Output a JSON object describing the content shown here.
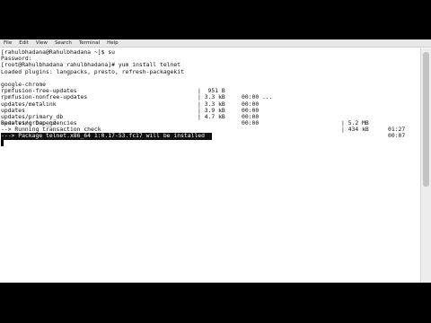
{
  "menu": [
    "File",
    "Edit",
    "View",
    "Search",
    "Terminal",
    "Help"
  ],
  "lines": [
    {
      "text": "[rahulbhadana@Rahulbhadana ~]$ su"
    },
    {
      "text": "Password:"
    },
    {
      "text": "[root@Rahulbhadana rahulbhadana]# yum install telnet"
    },
    {
      "text": "Loaded plugins: langpacks, presto, refresh-packagekit"
    },
    {
      "repo": "google-chrome",
      "size": "|  951 B",
      "time": "00:00 ..."
    },
    {
      "repo": "rpmfusion-free-updates",
      "size": "| 3.3 kB",
      "time": "00:00"
    },
    {
      "repo": "rpmfusion-nonfree-updates",
      "size": "| 3.3 kB",
      "time": "00:00"
    },
    {
      "repo": "updates/metalink",
      "size": "| 3.9 kB",
      "time": "00:00"
    },
    {
      "repo": "updates",
      "size": "| 4.7 kB",
      "time": "00:00"
    },
    {
      "repo": "updates/primary_db",
      "size2": "| 5.2 MB",
      "time2": "01:27"
    },
    {
      "repo": "updates/group_gz",
      "size2": "| 434 kB",
      "time2": "00:07"
    },
    {
      "text": "Resolving Dependencies"
    },
    {
      "text": "--> Running transaction check"
    }
  ],
  "highlight": "---> Package telnet.x86_64 1:0.17-53.fc17 will be installed"
}
